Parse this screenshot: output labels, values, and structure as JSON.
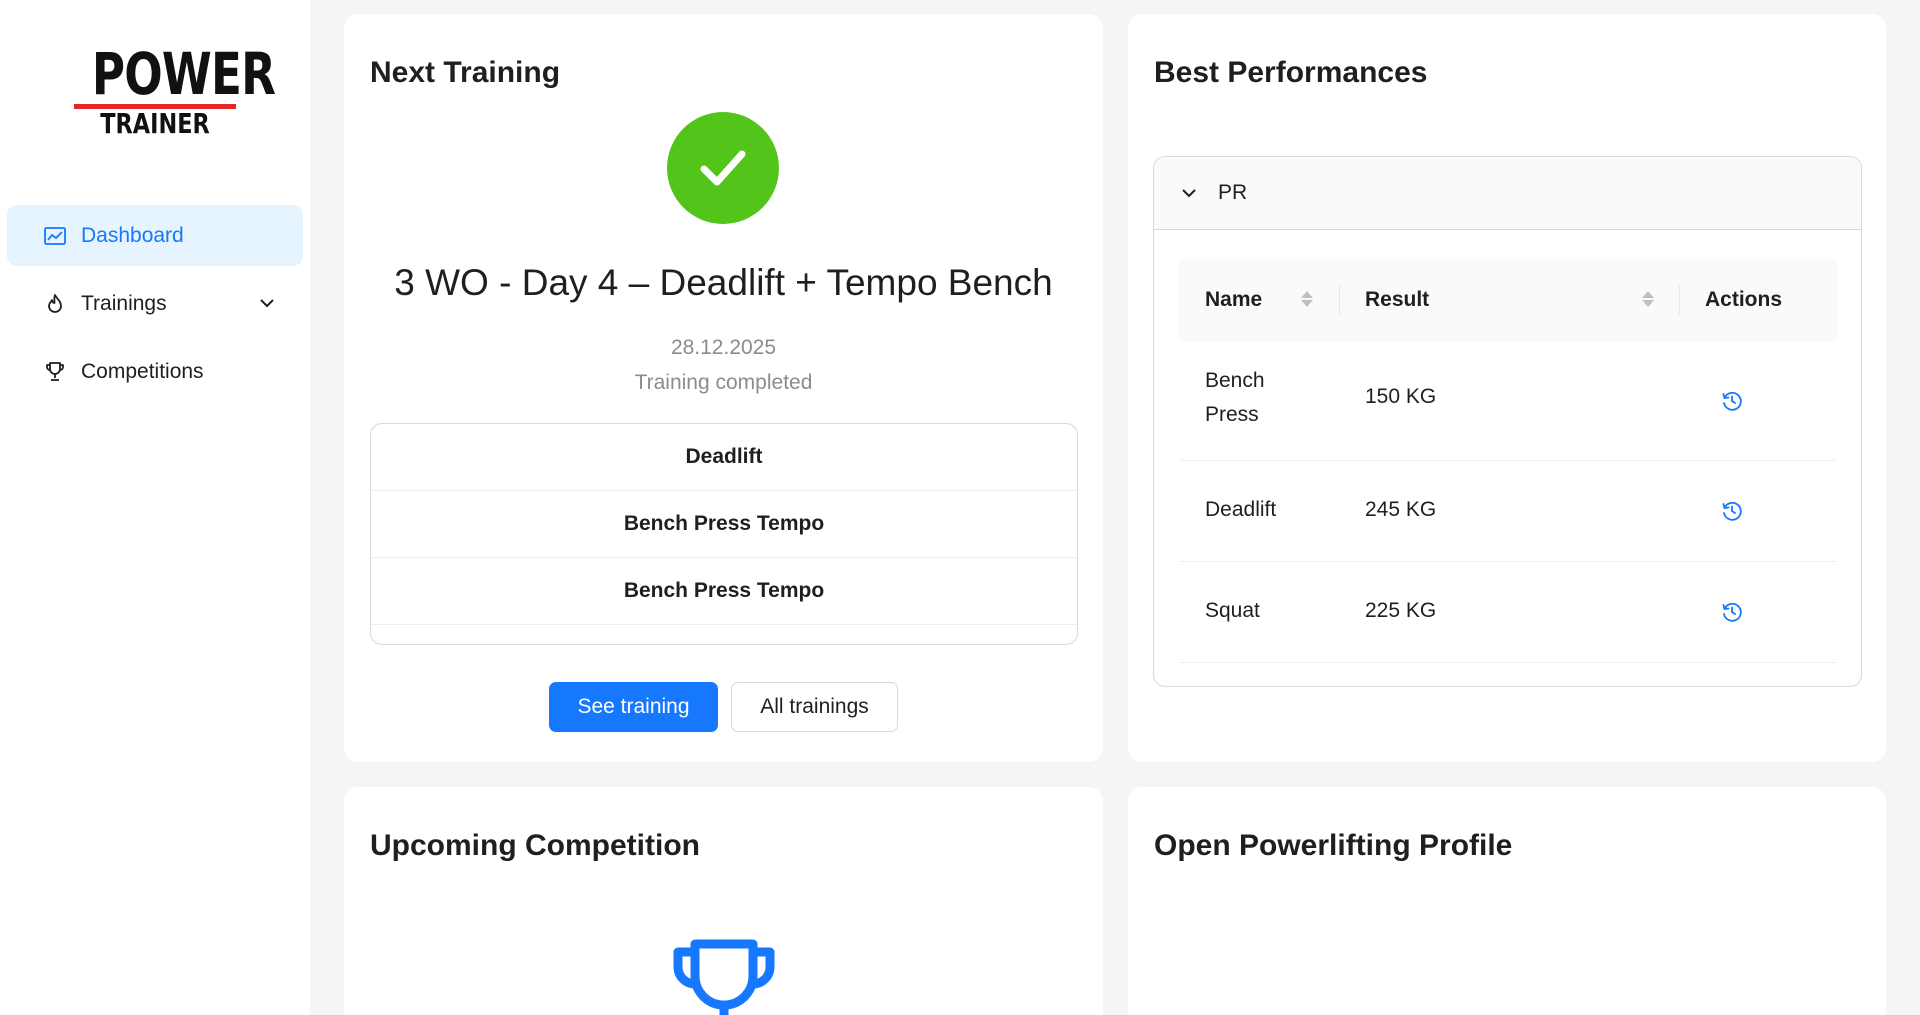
{
  "brand": {
    "logo_top": "POWER",
    "logo_bottom": "TRAINER",
    "accent_color": "#e32626"
  },
  "sidebar": {
    "items": [
      {
        "label": "Dashboard",
        "icon": "line-chart-icon",
        "active": true
      },
      {
        "label": "Trainings",
        "icon": "fire-icon",
        "has_submenu": true
      },
      {
        "label": "Competitions",
        "icon": "trophy-icon"
      }
    ]
  },
  "next_training": {
    "title": "Next Training",
    "status_icon": "check-circle-icon",
    "name": "3 WO - Day 4 – Deadlift + Tempo Bench",
    "date": "28.12.2025",
    "status": "Training completed",
    "exercises": [
      "Deadlift",
      "Bench Press Tempo",
      "Bench Press Tempo"
    ],
    "see_training_label": "See training",
    "all_trainings_label": "All trainings"
  },
  "best_performances": {
    "title": "Best Performances",
    "panel_label": "PR",
    "columns": [
      "Name",
      "Result",
      "Actions"
    ],
    "rows": [
      {
        "name": "Bench Press",
        "result": "150 KG",
        "action_icon": "history-icon"
      },
      {
        "name": "Deadlift",
        "result": "245 KG",
        "action_icon": "history-icon"
      },
      {
        "name": "Squat",
        "result": "225 KG",
        "action_icon": "history-icon"
      }
    ]
  },
  "upcoming_competition": {
    "title": "Upcoming Competition",
    "icon": "trophy-icon"
  },
  "open_powerlifting": {
    "title": "Open Powerlifting Profile"
  },
  "colors": {
    "primary": "#1677ff",
    "success": "#52c41a",
    "active_nav_bg": "#e6f4ff"
  }
}
